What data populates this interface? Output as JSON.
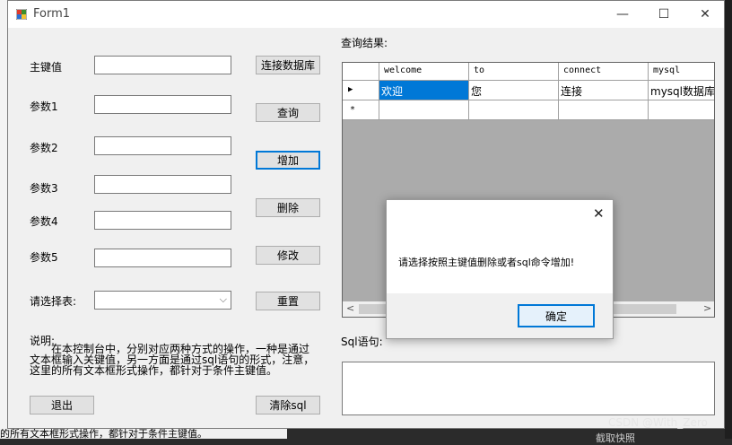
{
  "window": {
    "title": "Form1",
    "minimize": "—",
    "maximize": "☐",
    "close": "✕"
  },
  "form": {
    "labels": {
      "primary_key": "主键值",
      "param1": "参数1",
      "param2": "参数2",
      "param3": "参数3",
      "param4": "参数4",
      "param5": "参数5",
      "select_table": "请选择表:"
    },
    "buttons": {
      "connect": "连接数据库",
      "query": "查询",
      "add": "增加",
      "delete": "删除",
      "modify": "修改",
      "reset": "重置",
      "exit": "退出",
      "clear_sql": "清除sql"
    },
    "description_title": "说明:",
    "description_lines": [
      "在本控制台中，分别对应两种方式的操作，一种是通过",
      "文本框输入关键值，另一方面是通过sql语句的形式，注意，",
      "这里的所有文本框形式操作，都针对于条件主键值。"
    ]
  },
  "results": {
    "label": "查询结果:",
    "columns": [
      "welcome",
      "to",
      "connect",
      "mysql"
    ],
    "rows": [
      [
        "欢迎",
        "您",
        "连接",
        "mysql数据库"
      ]
    ],
    "current_row_marker": "▶",
    "new_row_marker": "*"
  },
  "sql": {
    "label": "Sql语句:"
  },
  "dialog": {
    "message": "请选择按照主键值删除或者sql命令增加!",
    "ok": "确定",
    "close": "✕"
  },
  "background": {
    "watermark": "CSDN @With_Zero",
    "bottom_left_text": "的所有文本框形式操作，都针对于条件主键值。",
    "bottom_right_text": "截取快照"
  }
}
